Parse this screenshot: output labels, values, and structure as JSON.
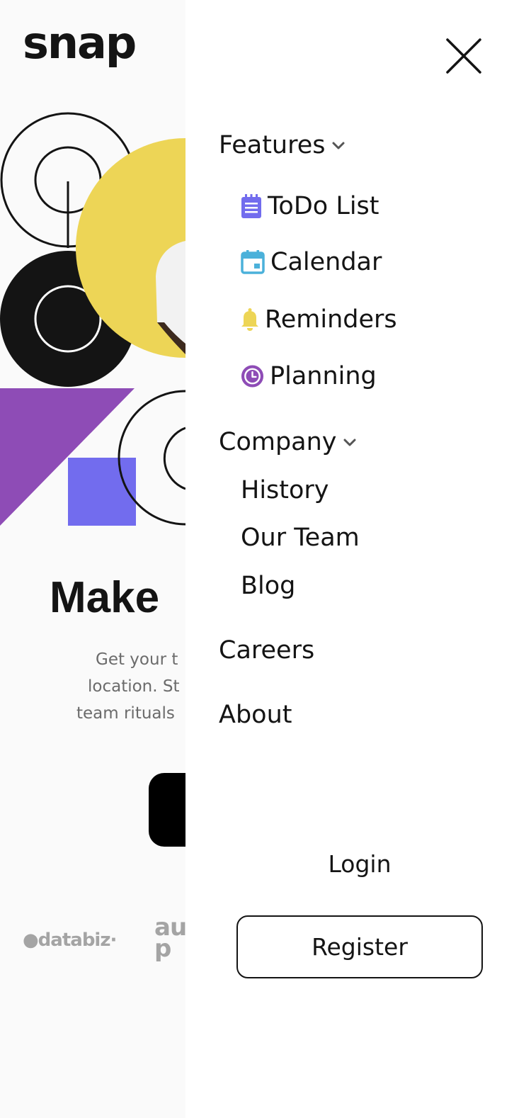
{
  "brand": {
    "logo": "snap"
  },
  "hero": {
    "title": "Make",
    "description_lines": [
      "Get your t",
      "location. St",
      "team rituals"
    ],
    "partner_logos": [
      "●databiz·",
      "au\np"
    ]
  },
  "drawer": {
    "close_icon": "close-icon",
    "features": {
      "label": "Features",
      "items": [
        {
          "label": "ToDo List",
          "icon": "todo-icon",
          "color": "#726cee"
        },
        {
          "label": "Calendar",
          "icon": "calendar-icon",
          "color": "#4bb1da"
        },
        {
          "label": "Reminders",
          "icon": "bell-icon",
          "color": "#edd556"
        },
        {
          "label": "Planning",
          "icon": "clock-icon",
          "color": "#8e4cb6"
        }
      ]
    },
    "company": {
      "label": "Company",
      "items": [
        {
          "label": "History"
        },
        {
          "label": "Our Team"
        },
        {
          "label": "Blog"
        }
      ]
    },
    "careers": "Careers",
    "about": "About",
    "login": "Login",
    "register": "Register"
  },
  "colors": {
    "text": "#141414",
    "muted": "#6b6b6b",
    "accent_purple": "#8e4cb6",
    "accent_blue": "#726cee",
    "accent_yellow": "#edd556"
  }
}
